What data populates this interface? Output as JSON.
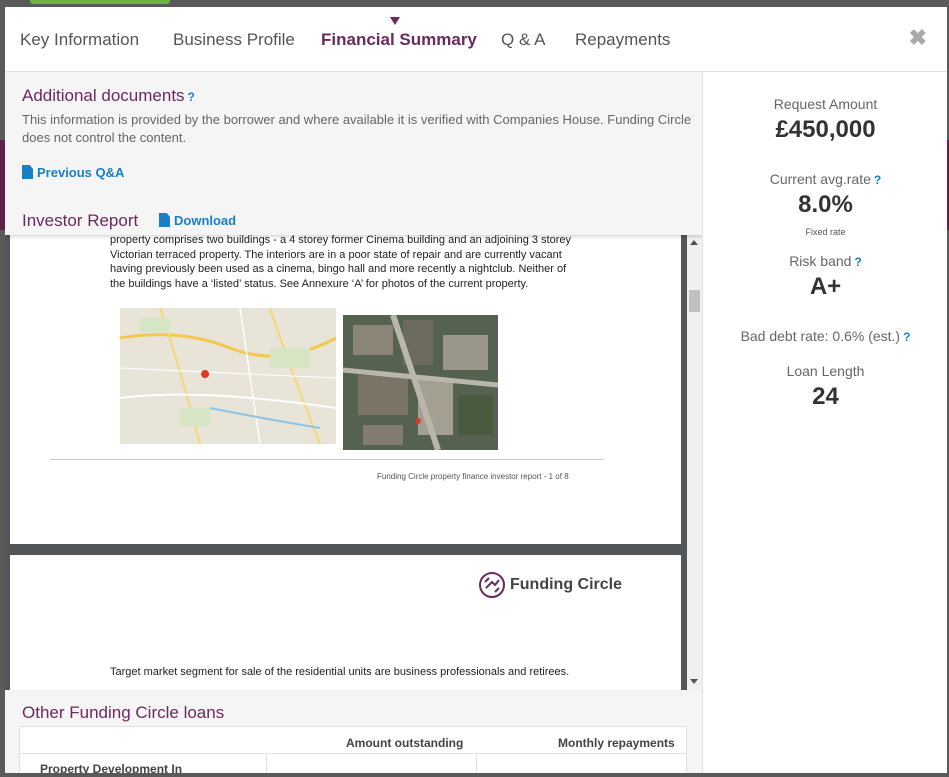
{
  "tabs": [
    {
      "label": "Key Information"
    },
    {
      "label": "Business Profile"
    },
    {
      "label": "Financial Summary"
    },
    {
      "label": "Q & A"
    },
    {
      "label": "Repayments"
    }
  ],
  "close_icon": "✖",
  "docs": {
    "title": "Additional documents",
    "help": "?",
    "description": "This information is provided by the borrower and where available it is verified with Companies House. Funding Circle does not control the content.",
    "previous_qa": "Previous Q&A",
    "investor_report": "Investor Report",
    "download": "Download"
  },
  "pdf": {
    "page1_lines": [
      "property comprises two buildings - a 4 storey former Cinema building and an adjoining 3 storey",
      "Victorian terraced property. The interiors are in a poor state of repair and are currently vacant",
      "having previously been used as a cinema, bingo hall and more recently a nightclub. Neither of",
      "the buildings have a ‘listed’ status. See Annexure ‘A’ for photos of the current property."
    ],
    "footer": "Funding Circle property finance investor report - 1 of 8",
    "logo_text": "Funding Circle",
    "page2_line": "Target market segment for sale of the residential units are business professionals and retirees."
  },
  "other_loans": {
    "title": "Other Funding Circle loans",
    "columns": [
      "Amount outstanding",
      "Monthly repayments"
    ],
    "first_row": "Property Development In"
  },
  "stats": {
    "request_amount_label": "Request Amount",
    "request_amount": "£450,000",
    "avg_rate_label": "Current avg.rate",
    "avg_rate": "8.0%",
    "fixed_rate": "Fixed rate",
    "risk_band_label": "Risk band",
    "risk_band": "A+",
    "bad_debt": "Bad debt rate: 0.6% (est.)",
    "loan_length_label": "Loan Length",
    "loan_length": "24",
    "help": "?"
  },
  "colors": {
    "brand_purple": "#6b2a5e",
    "link_blue": "#1a7fc3"
  }
}
